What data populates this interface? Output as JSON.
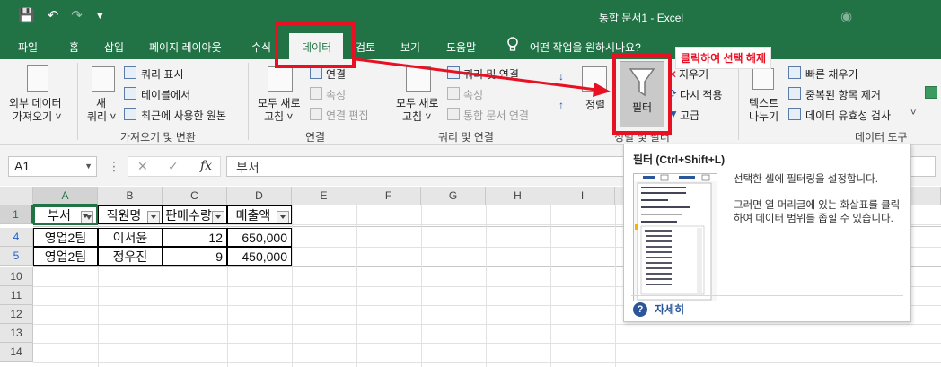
{
  "window": {
    "title": "통합 문서1  -  Excel"
  },
  "tabs": [
    {
      "label": "파일"
    },
    {
      "label": "홈"
    },
    {
      "label": "삽입"
    },
    {
      "label": "페이지 레이아웃"
    },
    {
      "label": "수식"
    },
    {
      "label": "데이터"
    },
    {
      "label": "검토"
    },
    {
      "label": "보기"
    },
    {
      "label": "도움말"
    },
    {
      "label": "어떤 작업을 원하시나요?"
    }
  ],
  "ribbon": {
    "get_data": {
      "external_line1": "외부 데이터",
      "external_line2": "가져오기 ˅",
      "new_query_line1": "새",
      "new_query_line2": "쿼리 ˅",
      "show_query": "쿼리 표시",
      "from_table": "테이블에서",
      "recent_sources": "최근에 사용한 원본",
      "group_label": "가져오기 및 변환"
    },
    "connections": {
      "refresh_line1": "모두 새로",
      "refresh_line2": "고침 ˅",
      "connections": "연결",
      "properties": "속성",
      "edit_links": "연결 편집",
      "group_label": "연결"
    },
    "queries": {
      "refresh_line1": "모두 새로",
      "refresh_line2": "고침 ˅",
      "queries_connections": "쿼리 및 연결",
      "properties": "속성",
      "edit_links": "통합 문서 연결",
      "group_label": "쿼리 및 연결"
    },
    "sort_filter": {
      "sort": "정렬",
      "filter": "필터",
      "clear": "지우기",
      "reapply": "다시 적용",
      "advanced": "고급",
      "group_label": "정렬 및 필터"
    },
    "data_tools": {
      "text_to_columns_line1": "텍스트",
      "text_to_columns_line2": "나누기",
      "flash_fill": "빠른 채우기",
      "remove_duplicates": "중복된 항목 제거",
      "data_validation": "데이터 유효성 검사",
      "group_label": "데이터 도구"
    }
  },
  "annotation": {
    "callout": "클릭하여 선택 해제"
  },
  "formula_bar": {
    "name_box": "A1",
    "content": "부서",
    "fx": "fx",
    "cancel": "✕",
    "enter": "✓"
  },
  "grid": {
    "columns": [
      "A",
      "B",
      "C",
      "D",
      "E",
      "F",
      "G",
      "H",
      "I"
    ],
    "rows": [
      "1",
      "4",
      "5",
      "10",
      "11",
      "12",
      "13",
      "14"
    ],
    "header_row": [
      "부서",
      "직원명",
      "판매수량",
      "매출액"
    ],
    "data_rows": [
      [
        "영업2팀",
        "이서윤",
        "12",
        "650,000"
      ],
      [
        "영업2팀",
        "정우진",
        "9",
        "450,000"
      ]
    ]
  },
  "tooltip": {
    "title": "필터 (Ctrl+Shift+L)",
    "desc1": "선택한 셀에 필터링을 설정합니다.",
    "desc2": "그러면 열 머리글에 있는 화살표를 클릭하여 데이터 범위를 좁힐 수 있습니다.",
    "more": "자세히"
  }
}
